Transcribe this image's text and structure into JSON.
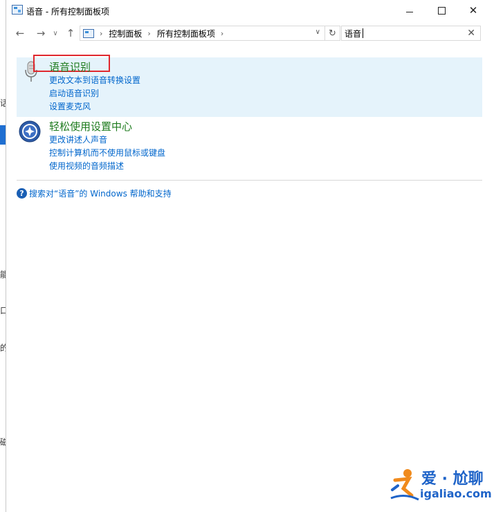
{
  "window": {
    "title": "语音 - 所有控制面板项",
    "minimize_icon": "minimize-icon",
    "maximize_icon": "maximize-icon",
    "close_glyph": "✕"
  },
  "nav": {
    "back": "←",
    "forward": "→",
    "recent": "∨",
    "up": "↑",
    "refresh": "↻",
    "breadcrumb": [
      "控制面板",
      "所有控制面板项"
    ],
    "breadcrumb_sep": "›",
    "address_dropdown": "∨"
  },
  "search": {
    "value": "语音",
    "clear": "✕"
  },
  "results": [
    {
      "title": "语音识别",
      "icon": "microphone-icon",
      "highlighted": true,
      "links": [
        "更改文本到语音转换设置",
        "启动语音识别",
        "设置麦克风"
      ]
    },
    {
      "title": "轻松使用设置中心",
      "icon": "ease-of-access-icon",
      "highlighted": false,
      "links": [
        "更改讲述人声音",
        "控制计算机而不使用鼠标或键盘",
        "使用视频的音频描述"
      ]
    }
  ],
  "help": {
    "text": "搜索对“语音”的 Windows 帮助和支持",
    "icon_glyph": "?"
  },
  "watermark": {
    "name": "爱 · 尬聊",
    "url": "igaliao.com"
  },
  "background_fragments": [
    "话",
    "能",
    "口",
    "的",
    "磁"
  ],
  "colors": {
    "accent": "#1f6fd1",
    "link": "#0066cc",
    "result_title": "#1e7b1e",
    "highlight_border": "#e0282e",
    "selected_row": "#e5f3fb"
  }
}
